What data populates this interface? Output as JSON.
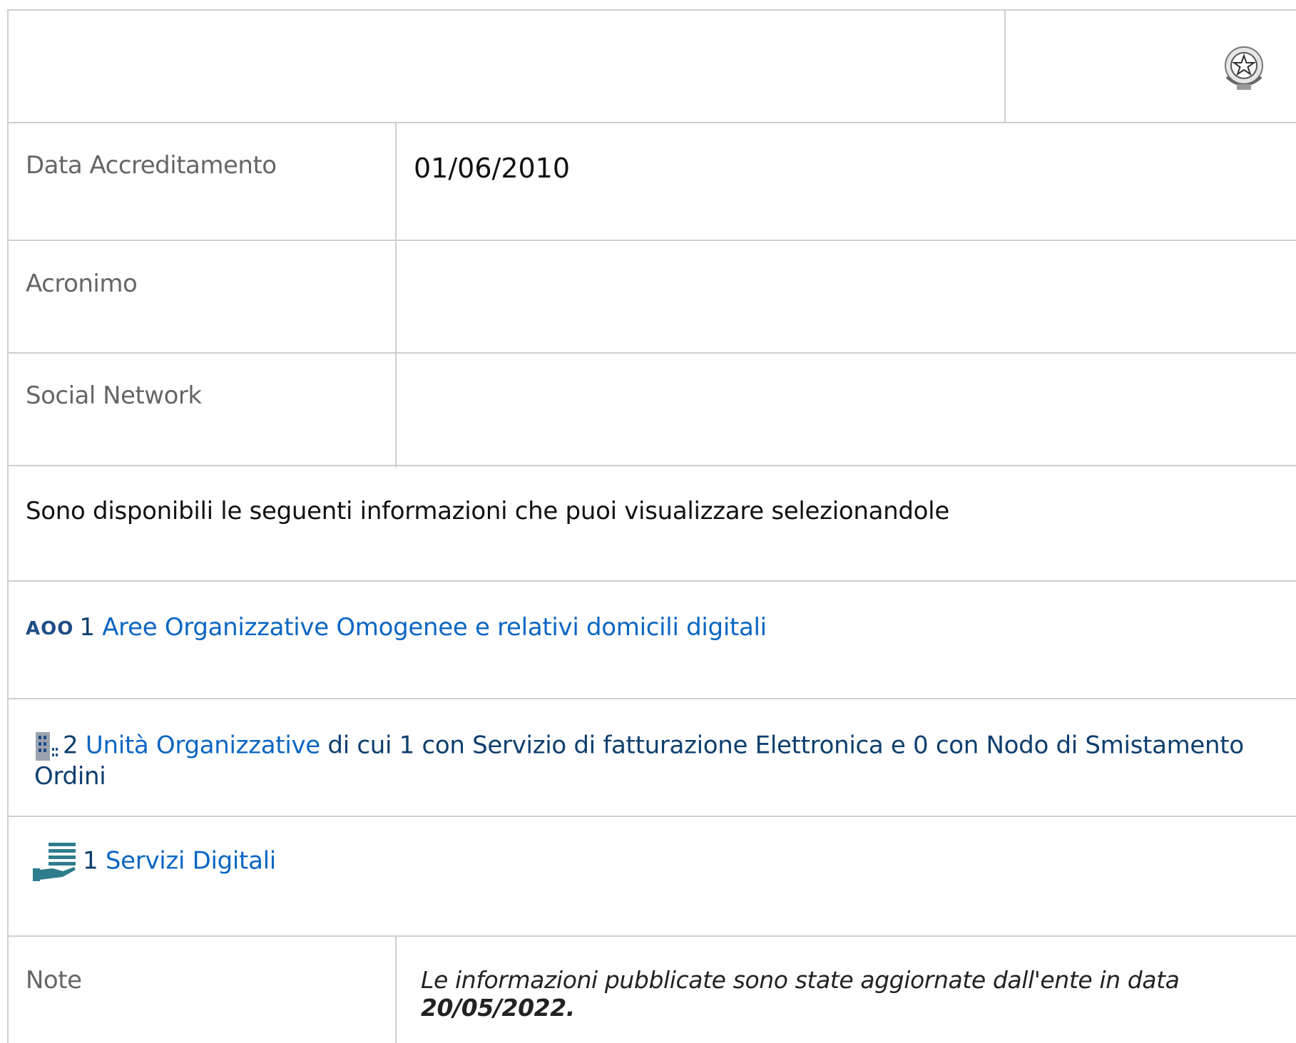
{
  "header": {
    "emblem_icon": "italian-republic-emblem-icon"
  },
  "rows": {
    "data_accreditamento": {
      "label": "Data Accreditamento",
      "value": "01/06/2010"
    },
    "acronimo": {
      "label": "Acronimo",
      "value": ""
    },
    "social_network": {
      "label": "Social Network",
      "value": ""
    }
  },
  "info": {
    "intro": "Sono disponibili le seguenti informazioni che puoi visualizzare selezionandole"
  },
  "aoo": {
    "icon": "AOO",
    "count": "1",
    "link": "Aree Organizzative Omogenee e relativi domicili digitali"
  },
  "uo": {
    "icon": "building-icon",
    "count": "2",
    "link": "Unità Organizzative",
    "rest": " di cui 1 con Servizio di fatturazione Elettronica e 0 con Nodo di Smistamento Ordini"
  },
  "servizi": {
    "icon": "hand-service-icon",
    "count": "1",
    "link": "Servizi Digitali"
  },
  "note": {
    "label": "Note",
    "text": "Le informazioni pubblicate sono state aggiornate dall'ente in data ",
    "date": "20/05/2022."
  },
  "colors": {
    "border": "#cfcfcf",
    "link": "#0b66c2",
    "dark_link": "#0d3e6e",
    "label": "#666666"
  }
}
